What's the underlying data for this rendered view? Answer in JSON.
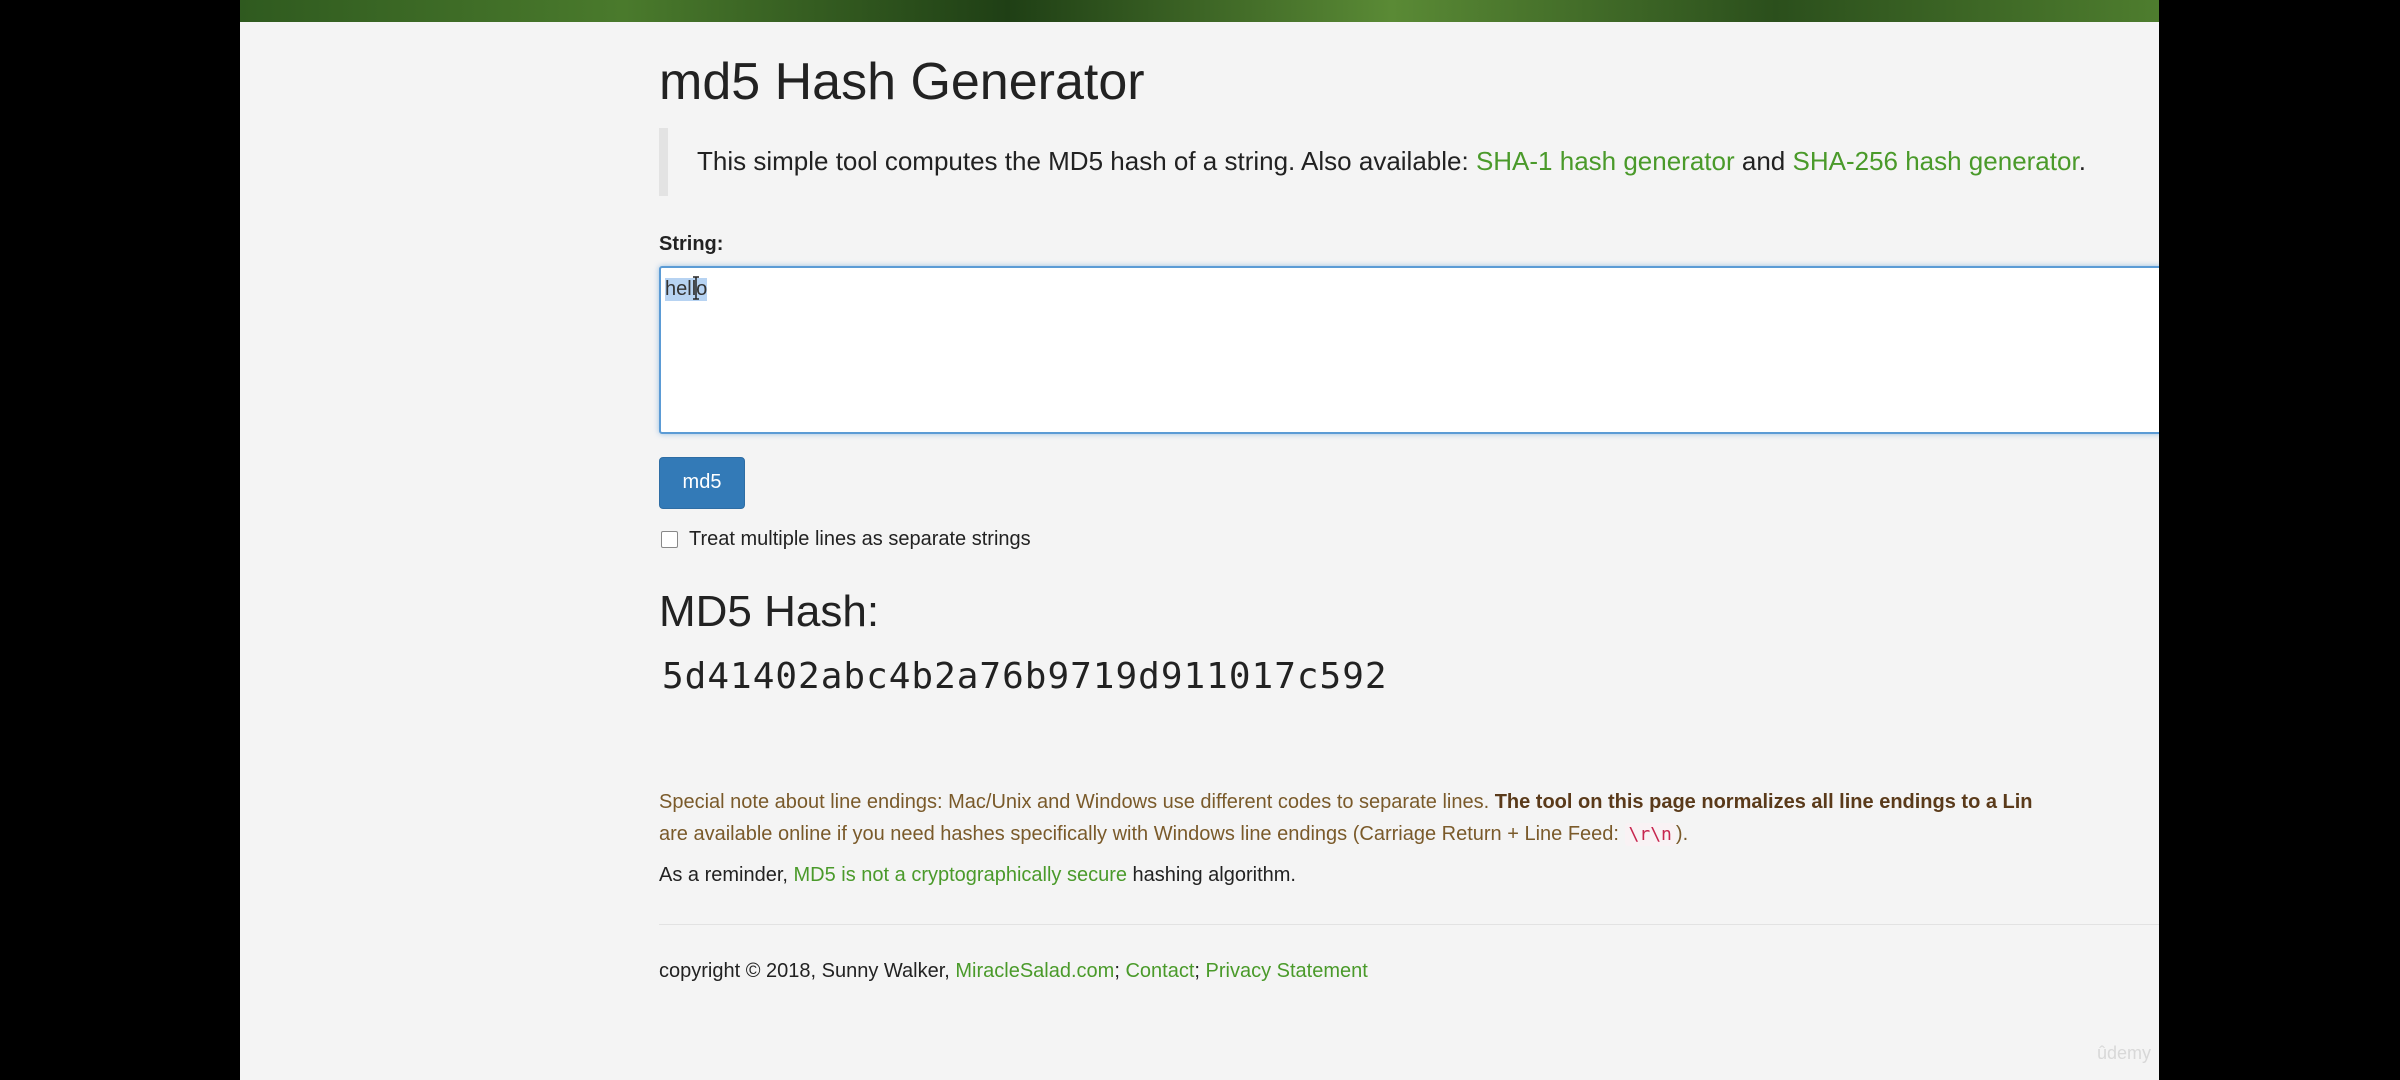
{
  "page": {
    "title": "md5 Hash Generator",
    "intro": {
      "text": "This simple tool computes the MD5 hash of a string. Also available: ",
      "link1": "SHA-1 hash generator",
      "and": " and ",
      "link2": "SHA-256 hash generator",
      "end": "."
    },
    "string_label": "String:",
    "input_value": "hello",
    "md5_button": "md5",
    "multi_lines_label": "Treat multiple lines as separate strings",
    "hash_heading": "MD5 Hash:",
    "hash_value": "5d41402abc4b2a76b9719d911017c592",
    "note": {
      "line1_text": "Special note about line endings: Mac/Unix and Windows use different codes to separate lines. ",
      "line1_bold": "The tool on this page normalizes all line endings to a Lin",
      "line2_text": "are available online if you need hashes specifically with Windows line endings (Carriage Return + Line Feed: ",
      "line2_code": "\\r\\n",
      "line2_end": ")."
    },
    "reminder": {
      "prefix": "As a reminder, ",
      "link": "MD5 is not a cryptographically secure",
      "suffix": " hashing algorithm."
    },
    "footer": {
      "copyright": "copyright © 2018, Sunny Walker, ",
      "link1": "MiracleSalad.com",
      "sep1": "; ",
      "link2": "Contact",
      "sep2": "; ",
      "link3": "Privacy Statement"
    },
    "watermark": "ûdemy"
  },
  "colors": {
    "link": "#4a9a2a",
    "button": "#337ab7",
    "note_text": "#7a5a2a",
    "background": "#f4f4f4"
  }
}
